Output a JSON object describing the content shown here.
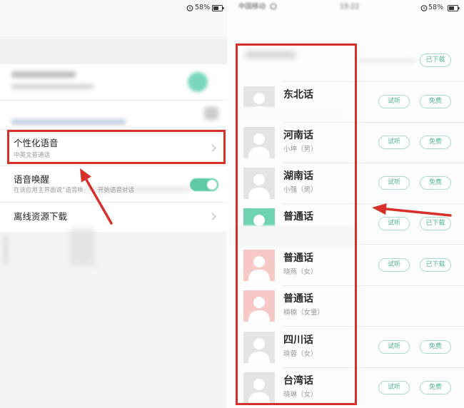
{
  "left_screen": {
    "status_bar": {
      "battery_percent": "58%"
    },
    "settings": {
      "personalized_voice": {
        "title": "个性化语音",
        "subtitle": "中英文普通话"
      },
      "voice_wakeup": {
        "title": "语音唤醒",
        "subtitle_start": "在该应用主界面说“语音唤",
        "subtitle_end": "开始语音对话",
        "toggle_on": true
      },
      "offline_download": {
        "title": "离线资源下载"
      }
    }
  },
  "right_screen": {
    "status_bar": {
      "carrier": "中国移动",
      "time": "15:22",
      "battery_percent": "58%"
    },
    "top_item": {
      "action_label": "已下载"
    },
    "voices": [
      {
        "name": "东北话",
        "avatar_color": "#e4e4e4",
        "preview_label": "试听",
        "action_label": "免费"
      },
      {
        "name": "河南话",
        "speaker": "小坤（男）",
        "avatar_color": "#e4e4e4",
        "preview_label": "试听",
        "action_label": "免费"
      },
      {
        "name": "湖南话",
        "speaker": "小强（男）",
        "avatar_color": "#e4e4e4",
        "preview_label": "试听",
        "action_label": "免费"
      },
      {
        "name": "普通话",
        "avatar_color": "#6fd4b3",
        "preview_label": "试听",
        "action_label": "已下载"
      },
      {
        "name": "普通话",
        "speaker": "晓燕（女）",
        "avatar_color": "#f6c8c6",
        "preview_label": "试听",
        "action_label": "已下载"
      },
      {
        "name": "普通话",
        "speaker": "楠楠（女童）",
        "avatar_color": "#f6c8c6"
      },
      {
        "name": "四川话",
        "speaker": "晓蓉（女）",
        "avatar_color": "#e4e4e4",
        "preview_label": "试听",
        "action_label": "免费"
      },
      {
        "name": "台湾话",
        "speaker": "晓琳（女）",
        "avatar_color": "#e4e4e4",
        "preview_label": "试听",
        "action_label": "免费"
      }
    ]
  },
  "colors": {
    "accent": "#4fb493",
    "pill_border": "#a9dccb",
    "toggle_on": "#5dc9a6",
    "annotation_red": "#d5302a",
    "text_primary": "#222222",
    "text_secondary": "#9a9a9a"
  },
  "icons": {
    "alarm": "alarm-icon",
    "battery": "battery-icon",
    "signal": "wifi-icon",
    "chevron": "chevron-right-icon",
    "avatar": "person-avatar-icon",
    "toggle": "toggle-switch"
  }
}
